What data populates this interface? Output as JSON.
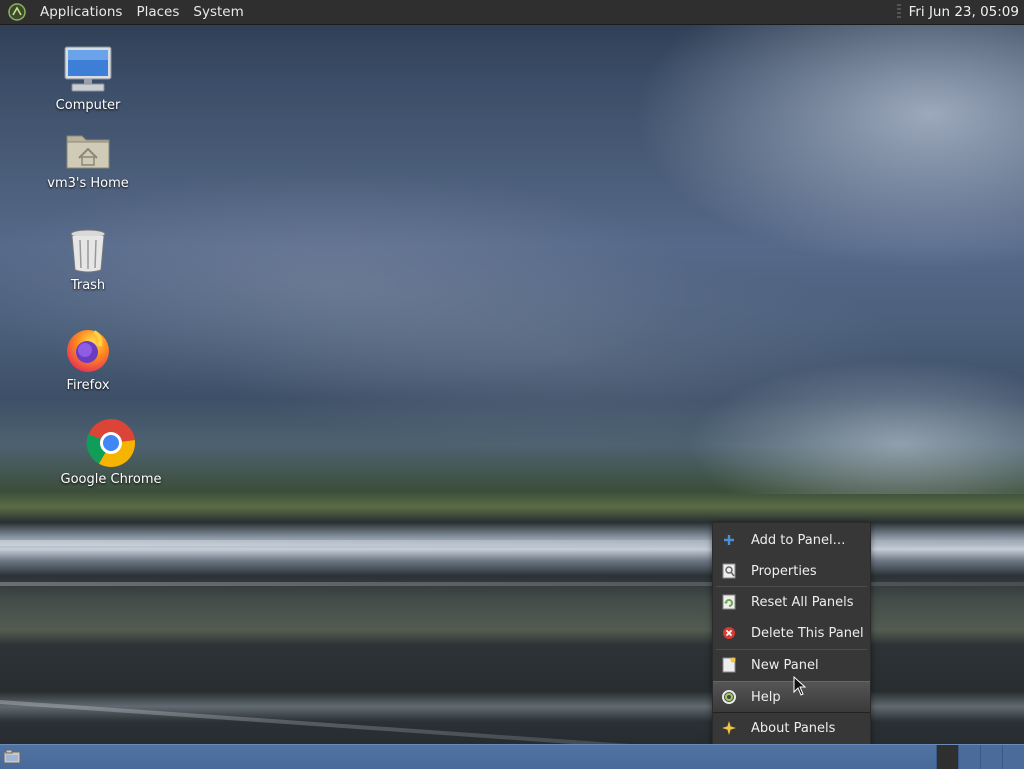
{
  "top_panel": {
    "menus": [
      "Applications",
      "Places",
      "System"
    ],
    "clock": "Fri Jun 23, 05:09"
  },
  "desktop": {
    "icons": [
      {
        "label": "Computer",
        "icon": "computer-icon"
      },
      {
        "label": "vm3's Home",
        "icon": "home-folder-icon"
      },
      {
        "label": "Trash",
        "icon": "trash-icon"
      },
      {
        "label": "Firefox",
        "icon": "firefox-icon"
      },
      {
        "label": "Google Chrome",
        "icon": "chrome-icon"
      }
    ]
  },
  "context_menu": {
    "items": [
      {
        "label": "Add to Panel…",
        "icon": "add-icon"
      },
      {
        "label": "Properties",
        "icon": "properties-icon"
      },
      {
        "label": "Reset All Panels",
        "icon": "reset-icon"
      },
      {
        "label": "Delete This Panel",
        "icon": "delete-icon"
      },
      {
        "label": "New Panel",
        "icon": "new-panel-icon"
      },
      {
        "label": "Help",
        "icon": "help-icon",
        "highlighted": true
      },
      {
        "label": "About Panels",
        "icon": "about-icon"
      }
    ]
  },
  "bottom_panel": {
    "workspaces": 4,
    "current_workspace": 1
  },
  "colors": {
    "panel_top": "#2f2f2f",
    "panel_bottom": "#4b6c9a",
    "menu_bg": "#373737",
    "accent_blue": "#4a90d9"
  }
}
